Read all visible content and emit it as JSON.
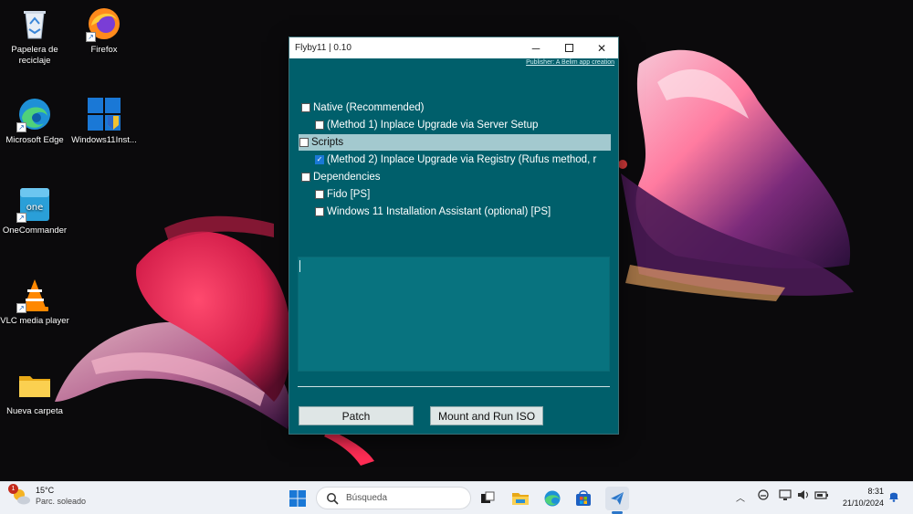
{
  "desktop": {
    "icons": [
      {
        "label": "Papelera de\nreciclaje",
        "icon": "recycle-bin-icon"
      },
      {
        "label": "Firefox",
        "icon": "firefox-icon"
      },
      {
        "label": "Microsoft Edge",
        "icon": "edge-icon"
      },
      {
        "label": "Windows11Inst...",
        "icon": "windows-installer-icon"
      },
      {
        "label": "OneCommander",
        "icon": "onecommander-icon"
      },
      {
        "label": "VLC media player",
        "icon": "vlc-icon"
      },
      {
        "label": "Nueva carpeta",
        "icon": "folder-icon"
      }
    ]
  },
  "window": {
    "title": "Flyby11 | 0.10",
    "publisher_link": "Publisher: A Belim app creation",
    "options": [
      {
        "label": "Native (Recommended)",
        "checked": false,
        "indent": 0
      },
      {
        "label": "(Method 1) Inplace Upgrade via Server Setup",
        "checked": false,
        "indent": 1
      },
      {
        "label": "Scripts",
        "checked": false,
        "indent": 0,
        "selected": true
      },
      {
        "label": "(Method 2) Inplace Upgrade via Registry (Rufus method, r",
        "checked": true,
        "indent": 1
      },
      {
        "label": "Dependencies",
        "checked": false,
        "indent": 0
      },
      {
        "label": "Fido [PS]",
        "checked": false,
        "indent": 1
      },
      {
        "label": "Windows 11 Installation Assistant (optional) [PS]",
        "checked": false,
        "indent": 1
      }
    ],
    "log_text": "",
    "buttons": {
      "patch": "Patch",
      "mount": "Mount and Run ISO"
    }
  },
  "taskbar": {
    "weather": {
      "temp": "15°C",
      "condition": "Parc. soleado",
      "badge": "1"
    },
    "search_placeholder": "Búsqueda",
    "clock": {
      "time": "8:31",
      "date": "21/10/2024"
    }
  },
  "colors": {
    "window_bg": "#005f6b",
    "selected_row": "#a3c9cf",
    "log_bg": "#08737f",
    "taskbar_bg": "#eef1f6",
    "accent": "#1a78d6"
  }
}
